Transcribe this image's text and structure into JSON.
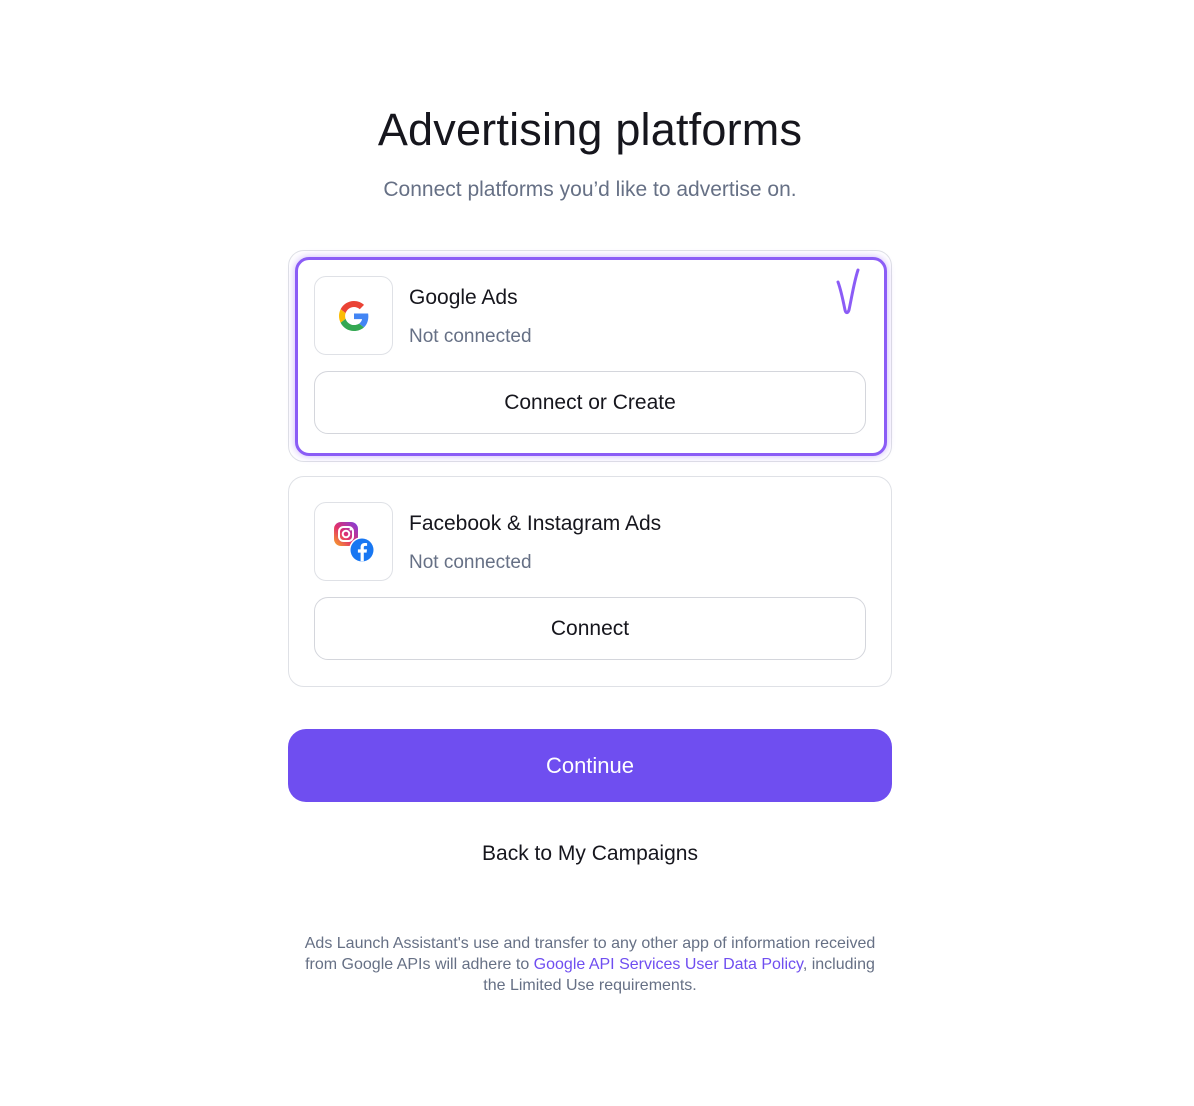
{
  "header": {
    "title": "Advertising platforms",
    "subtitle": "Connect platforms you’d like to advertise on."
  },
  "platforms": [
    {
      "name": "Google Ads",
      "status": "Not connected",
      "button_label": "Connect or Create",
      "icon": "google-logo-icon",
      "highlighted": true
    },
    {
      "name": "Facebook & Instagram Ads",
      "status": "Not connected",
      "button_label": "Connect",
      "icon": "facebook-instagram-logo-icon",
      "highlighted": false
    }
  ],
  "actions": {
    "continue_label": "Continue",
    "back_label": "Back to My Campaigns"
  },
  "footer": {
    "text_before": "Ads Launch Assistant's use and transfer to any other app of information received from Google APIs will adhere to ",
    "link_text": "Google API Services User Data Policy",
    "text_after": ", including the Limited Use requirements."
  },
  "colors": {
    "accent": "#6f4ef0",
    "highlight": "#8b5cf6",
    "muted_text": "#667085",
    "border": "#dfe1e6"
  },
  "annotations": {
    "check_mark": "check-mark-annotation"
  }
}
